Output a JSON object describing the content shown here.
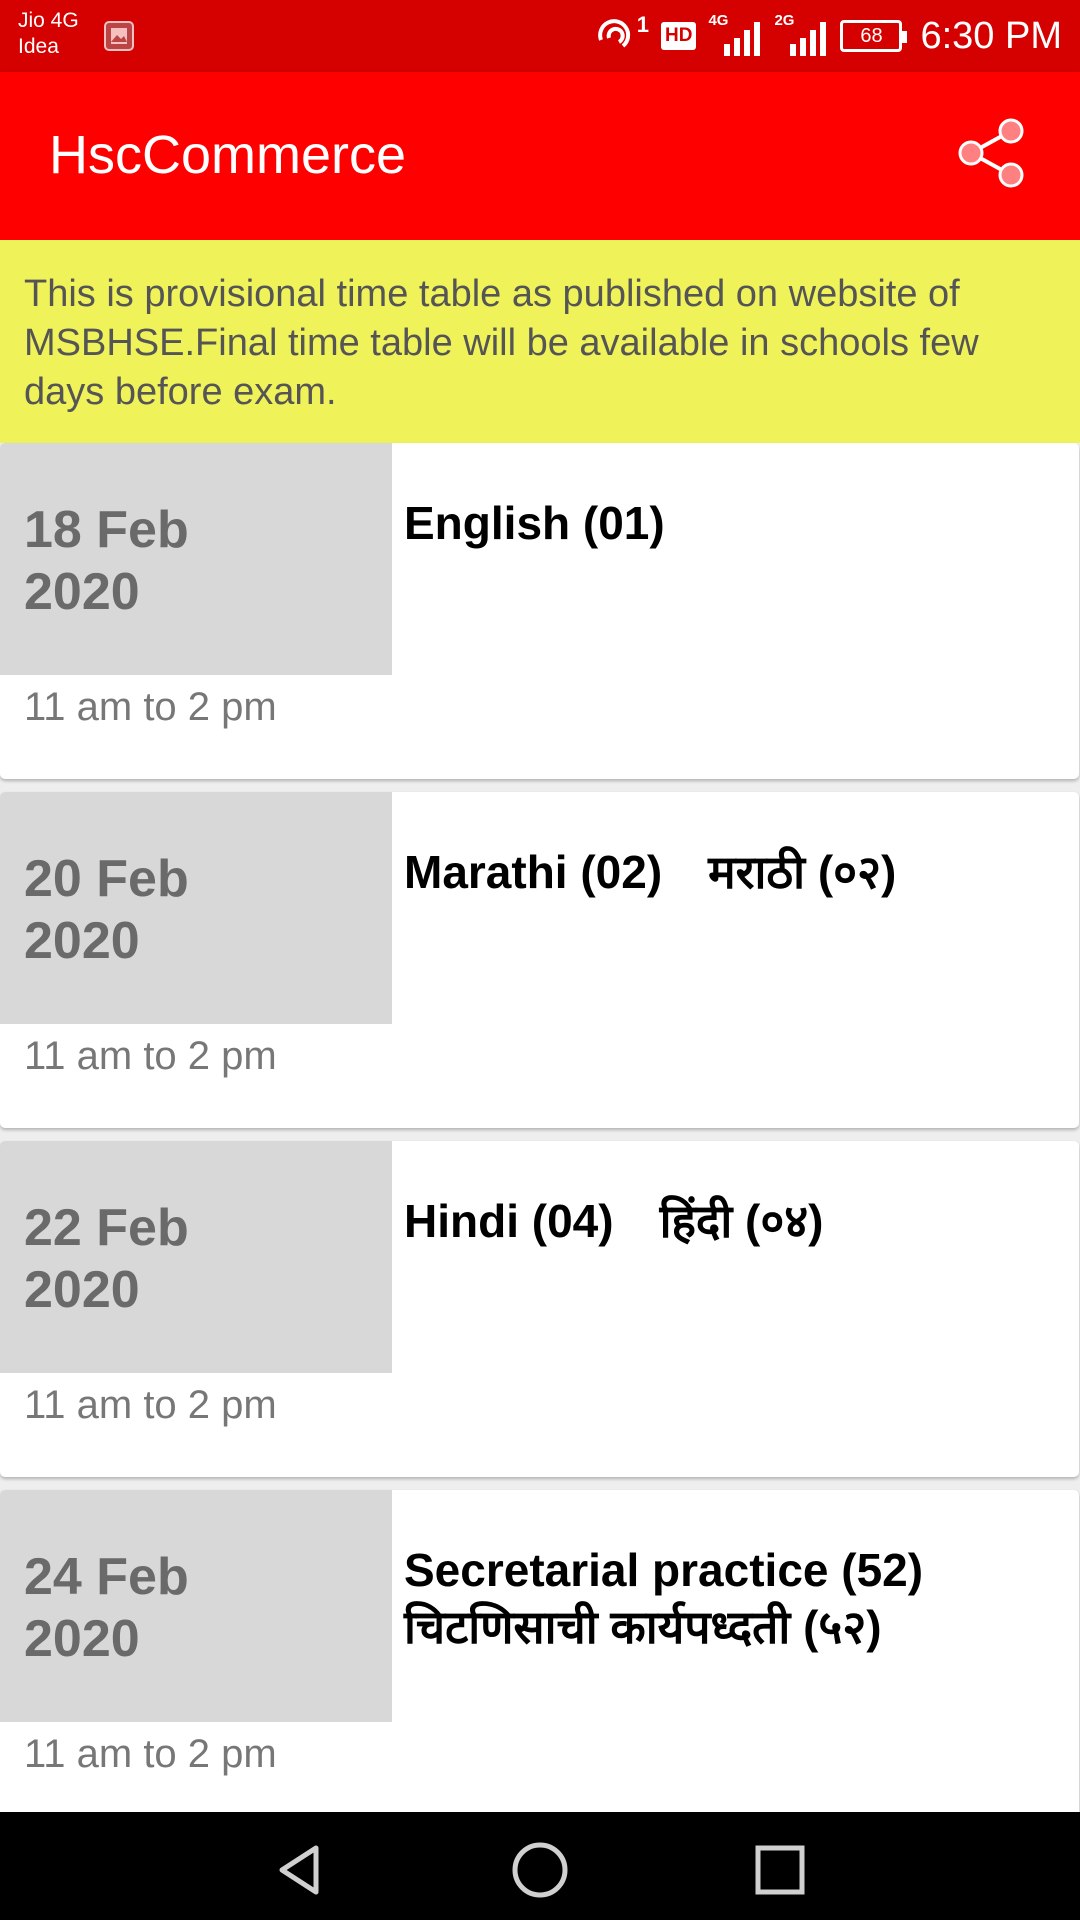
{
  "status_bar": {
    "carrier_line1": "Jio 4G",
    "carrier_line2": "Idea",
    "sync_badge": "1",
    "hd_label": "HD",
    "sim1_net": "4G",
    "sim2_net": "2G",
    "battery": "68",
    "time": "6:30 PM"
  },
  "app_bar": {
    "title": "HscCommerce",
    "share_icon": "share-icon"
  },
  "notice": {
    "text": "This is provisional time table as published on website of MSBHSE.Final time table will be available in schools few days before exam."
  },
  "exams": [
    {
      "date_day": "18 Feb",
      "date_year": "2020",
      "time": "11 am to 2 pm",
      "subject_en": "English (01)",
      "subject_mr": ""
    },
    {
      "date_day": "20 Feb",
      "date_year": "2020",
      "time": "11 am to 2 pm",
      "subject_en": "Marathi (02)",
      "subject_mr": "मराठी (०२)"
    },
    {
      "date_day": "22 Feb",
      "date_year": "2020",
      "time": "11 am to 2 pm",
      "subject_en": "Hindi (04)",
      "subject_mr": "हिंदी (०४)"
    },
    {
      "date_day": "24 Feb",
      "date_year": "2020",
      "time": "11 am to 2 pm",
      "subject_en": "Secretarial practice (52)",
      "subject_mr": "चिटणिसाची कार्यपध्दती (५२)"
    }
  ],
  "colors": {
    "status_bar": "#d50000",
    "app_bar": "#ff0000",
    "notice_bg": "#f0f25a",
    "date_bg": "#d8d8d8"
  }
}
